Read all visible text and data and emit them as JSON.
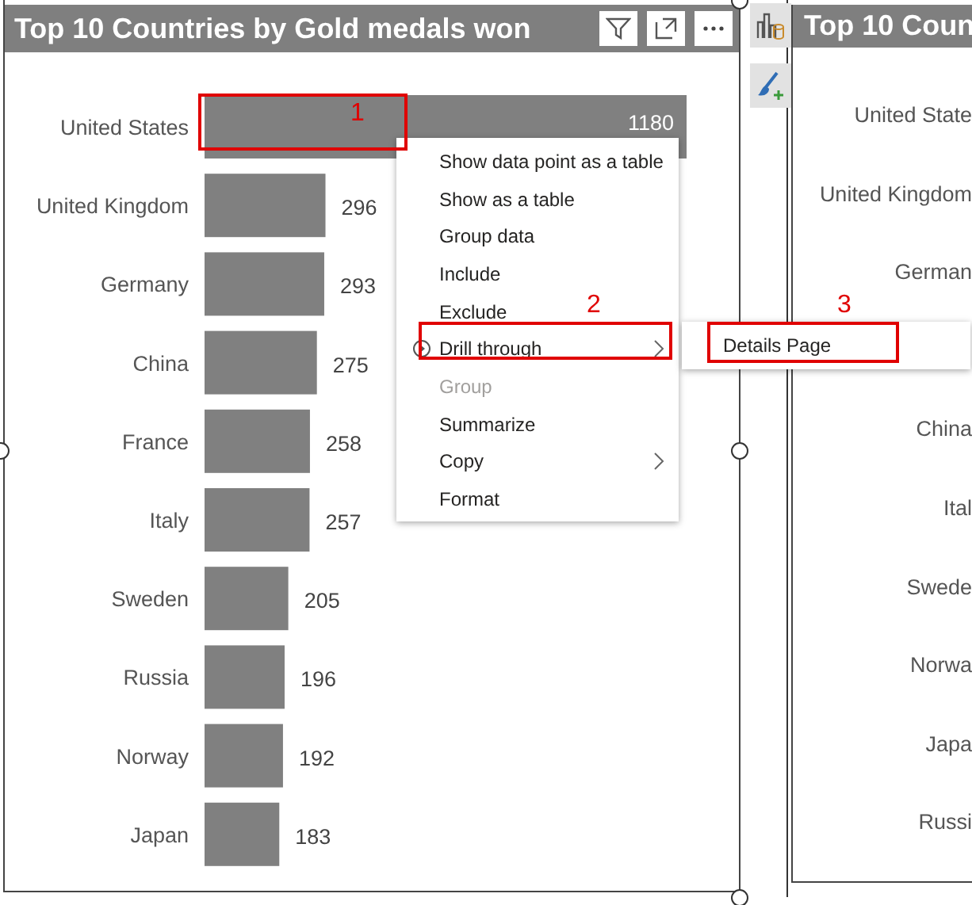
{
  "visual": {
    "title": "Top 10 Countries by Gold medals won",
    "chart_data": {
      "type": "bar",
      "orientation": "horizontal",
      "data_labels": true,
      "categories": [
        "United States",
        "United Kingdom",
        "Germany",
        "China",
        "France",
        "Italy",
        "Sweden",
        "Russia",
        "Norway",
        "Japan"
      ],
      "series": [
        {
          "color": "#808080",
          "values": [
            1180,
            296,
            293,
            275,
            258,
            257,
            205,
            196,
            192,
            183
          ]
        }
      ]
    }
  },
  "context_menu": {
    "items": [
      {
        "label": "Show data point as a table",
        "kind": "plain",
        "disabled": false
      },
      {
        "label": "Show as a table",
        "kind": "plain",
        "disabled": false
      },
      {
        "label": "Group data",
        "kind": "plain",
        "disabled": false
      },
      {
        "label": "Include",
        "kind": "plain",
        "disabled": false
      },
      {
        "label": "Exclude",
        "kind": "plain",
        "disabled": false
      },
      {
        "label": "Drill through",
        "kind": "drill",
        "disabled": false
      },
      {
        "label": "Group",
        "kind": "plain",
        "disabled": true
      },
      {
        "label": "Summarize",
        "kind": "plain",
        "disabled": false
      },
      {
        "label": "Copy",
        "kind": "submenu",
        "disabled": false
      },
      {
        "label": "Format",
        "kind": "plain",
        "disabled": false
      }
    ]
  },
  "submenu": {
    "items": [
      {
        "label": "Details Page"
      }
    ]
  },
  "callouts": [
    {
      "number": "1"
    },
    {
      "number": "2"
    },
    {
      "number": "3"
    }
  ],
  "second_visual": {
    "title": "Top 10 Coun",
    "labels": [
      "United State",
      "United Kingdom",
      "German",
      "China",
      "Ital",
      "Swede",
      "Norwa",
      "Japa",
      "Russi"
    ]
  }
}
